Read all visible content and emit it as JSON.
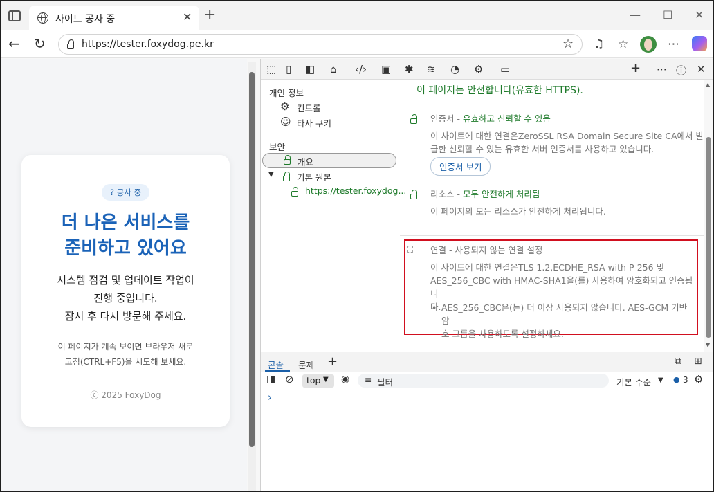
{
  "browser": {
    "tab_title": "사이트 공사 중",
    "tab_close": "✕",
    "new_tab": "+",
    "address": "https://tester.foxydog.pe.kr",
    "window_controls": {
      "minimize": "—",
      "maximize": "☐",
      "close": "✕"
    }
  },
  "page": {
    "badge": "? 공사 중",
    "headline": [
      "더 나은 서비스를",
      "준비하고 있어요"
    ],
    "description": [
      "시스템 점검 및 업데이트 작업이",
      "진행 중입니다.",
      "잠시 후 다시 방문해 주세요."
    ],
    "note": [
      "이 페이지가 계속 보이면 브라우저 새로",
      "고침(CTRL+F5)을 시도해 보세요."
    ],
    "footer": "ⓒ 2025 FoxyDog"
  },
  "devtools": {
    "toolbar_icons": [
      "inspect-icon",
      "device-icon",
      "sidebar-icon",
      "home-icon",
      "elements-icon",
      "console-icon",
      "sources-icon",
      "network-icon",
      "performance-icon",
      "settings-gear-icon",
      "application-icon",
      "plus-icon",
      "more-icon",
      "help-icon",
      "close-icon"
    ],
    "sidebar": {
      "privacy_header": "개인 정보",
      "controls": "컨트롤",
      "third_party_cookies": "타사 쿠키",
      "security_header": "보안",
      "overview": "개요",
      "main_origin": "기본 원본",
      "origin_url": "https://tester.foxydog..."
    },
    "main": {
      "summary": "이 페이지는 안전합니다(유효한 HTTPS).",
      "cert_label": "인증서",
      "cert_status": "유효하고 신뢰할 수 있음",
      "cert_desc": [
        "이 사이트에 대한 연결은ZeroSSL RSA Domain Secure Site CA에서 발",
        "급한 신뢰할 수 있는 유효한 서버 인증서를 사용하고 있습니다."
      ],
      "cert_button": "인증서 보기",
      "res_label": "리소스",
      "res_status": "모두 안전하게 처리됨",
      "res_desc": "이 페이지의 모든 리소스가 안전하게 처리됩니다.",
      "conn_label": "연결",
      "conn_status": "사용되지 않는 연결 설정",
      "conn_desc": [
        "이 사이트에 대한 연결은TLS 1.2,ECDHE_RSA with P-256 및",
        "AES_256_CBC with HMAC-SHA1을(를) 사용하여 암호화되고 인증됩니",
        "다."
      ],
      "conn_bullet": [
        "AES_256_CBC은(는) 더 이상 사용되지 않습니다. AES-GCM 기반 암",
        "호 그룹을 사용하도록 설정하세요."
      ]
    },
    "drawer": {
      "tab_console": "콘솔",
      "tab_issues": "문제",
      "context": "top",
      "filter_placeholder": "필터",
      "levels": "기본 수준",
      "issues_count": "3",
      "prompt": "›"
    }
  }
}
